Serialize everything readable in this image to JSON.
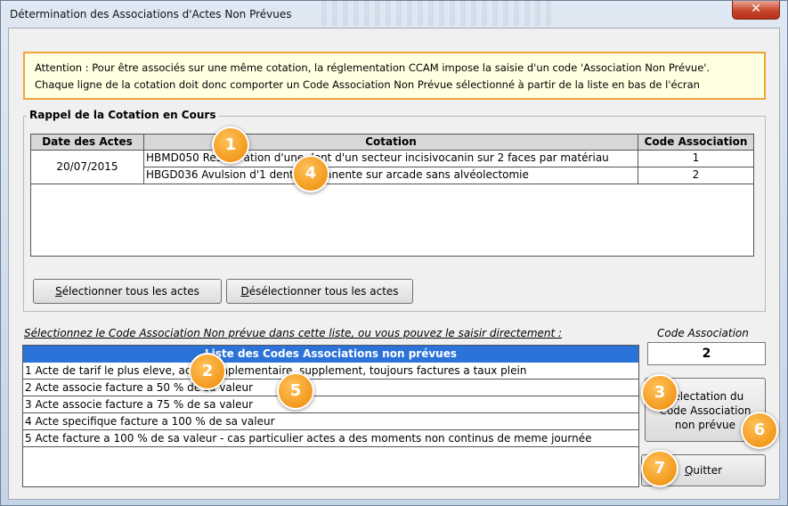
{
  "window": {
    "title": "Détermination des Associations d'Actes Non Prévues",
    "close_label": "✕"
  },
  "attention": {
    "line1": "Attention : Pour être associés sur une même cotation, la réglementation CCAM impose la saisie d'un code 'Association Non Prévue'.",
    "line2": "Chaque ligne de la cotation doit donc comporter un Code Association Non Prévue sélectionné à partir de la liste en bas de l'écran"
  },
  "rappel": {
    "legend": "Rappel de la Cotation en Cours",
    "headers": {
      "date": "Date des Actes",
      "cotation": "Cotation",
      "code": "Code Association"
    },
    "date": "20/07/2015",
    "rows": [
      {
        "cotation": "HBMD050 Restauration d'une dent d'un secteur incisivocanin sur 2 faces par matériau",
        "code": "1"
      },
      {
        "cotation": "HBGD036 Avulsion d'1 dent permanente sur arcade sans alvéolectomie",
        "code": "2"
      }
    ],
    "select_all_label": "électionner tous les actes",
    "select_all_mnemonic": "S",
    "deselect_all_label": "ésélectionner tous les actes",
    "deselect_all_mnemonic": "D"
  },
  "selection": {
    "instruction": "Sélectionnez le Code Association Non prévue dans cette liste, ou vous pouvez le saisir directement :",
    "code_label": "Code Association",
    "code_value": "2",
    "list_header": "Liste des Codes Associations non prévues",
    "codes": [
      "1 Acte de tarif le plus eleve, acte complementaire, supplement, toujours factures a taux plein",
      "2 Acte associe facture a 50 % de sa valeur",
      "3 Acte associe facture a 75 % de sa valeur",
      "4 Acte specifique facture a 100 % de sa valeur",
      "5 Acte facture a 100 % de sa valeur - cas particulier actes a des moments non continus de meme journée"
    ],
    "validate_lines": [
      "Sélectation du",
      "Code Association",
      "non prévue"
    ],
    "quit_label": "uitter",
    "quit_mnemonic": "Q"
  },
  "badges": [
    "1",
    "4",
    "2",
    "5",
    "3",
    "6",
    "7"
  ],
  "colors": {
    "badge": "#f39a1e",
    "list_header": "#2b73d9",
    "attention_border": "#f2a33c"
  }
}
